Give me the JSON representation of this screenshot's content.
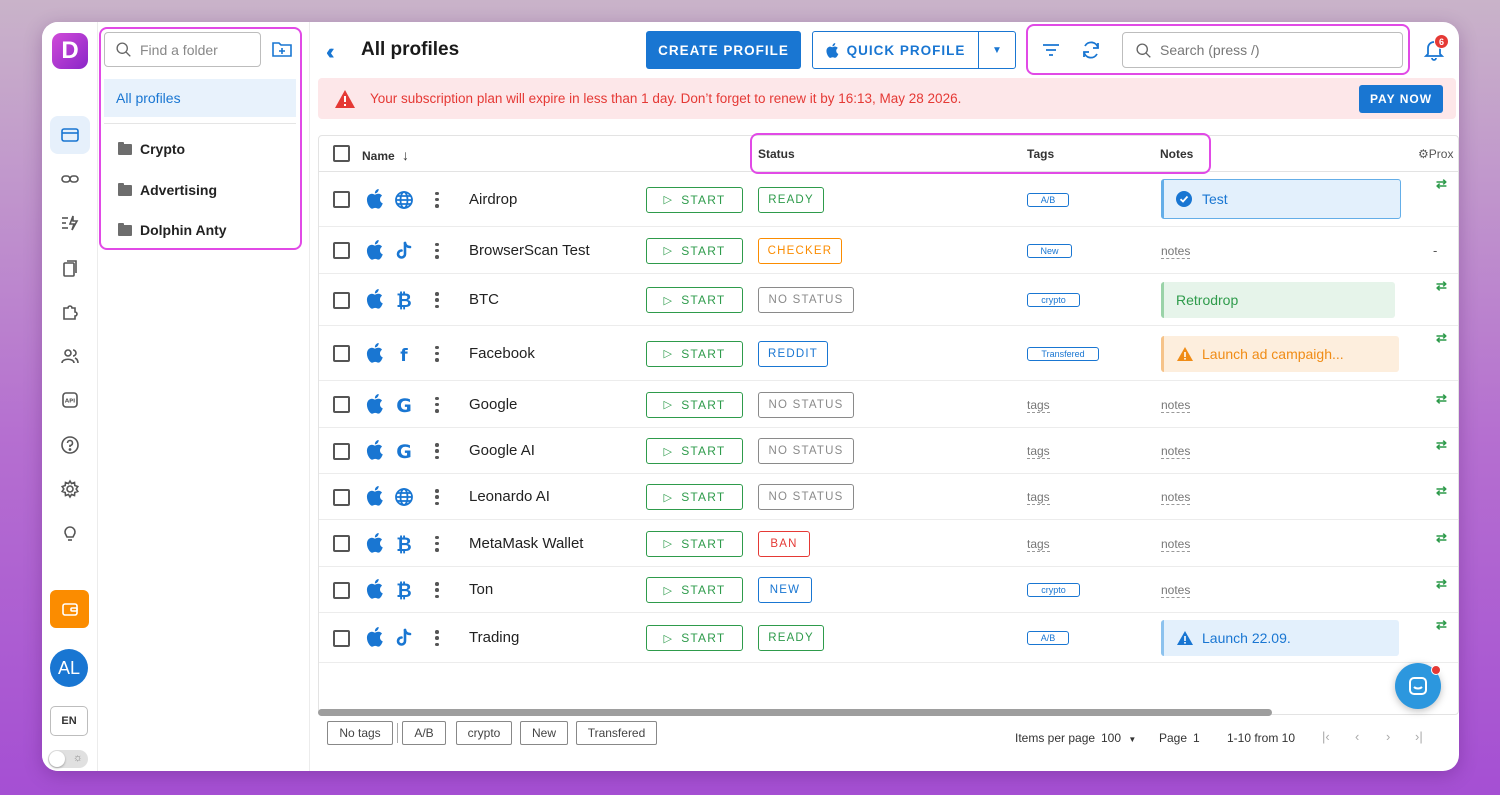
{
  "colors": {
    "accent": "#1976d2",
    "green": "#2e9b4b",
    "orange": "#fb8c00",
    "red": "#e53935",
    "highlight": "#e14ae6"
  },
  "rail": {
    "logo": "D",
    "items": [
      "browser-icon",
      "link-icon",
      "automation-icon",
      "clipboard-icon",
      "extension-icon",
      "users-icon",
      "api-icon",
      "help-icon",
      "settings-icon",
      "lightbulb-icon"
    ],
    "api_label": "API",
    "wallet_icon": "wallet-icon",
    "avatar": "AL",
    "language": "EN"
  },
  "folders": {
    "search_placeholder": "Find a folder",
    "all_label": "All profiles",
    "items": [
      "Crypto",
      "Advertising",
      "Dolphin Anty"
    ]
  },
  "header": {
    "title": "All profiles",
    "create_label": "CREATE PROFILE",
    "quick_label": "QUICK PROFILE",
    "search_placeholder": "Search (press /)",
    "notifications": "6"
  },
  "alert": {
    "message": "Your subscription plan will expire in less than 1 day. Don’t forget to renew it by 16:13, May 28 2026.",
    "action": "PAY NOW"
  },
  "table": {
    "columns": {
      "name": "Name",
      "status": "Status",
      "tags": "Tags",
      "notes": "Notes",
      "proxy": "Prox"
    },
    "start_label": "START",
    "rows": [
      {
        "name": "Airdrop",
        "site_icon": "globe-icon",
        "status": "READY",
        "tag": "A/B",
        "note": "Test"
      },
      {
        "name": "BrowserScan Test",
        "site_icon": "tiktok-icon",
        "status": "CHECKER",
        "tag": "New",
        "note": "notes"
      },
      {
        "name": "BTC",
        "site_icon": "bitcoin-icon",
        "status": "NO STATUS",
        "tag": "crypto",
        "note": "Retrodrop"
      },
      {
        "name": "Facebook",
        "site_icon": "facebook-icon",
        "status": "REDDIT",
        "tag": "Transfered",
        "note": "Launch ad campaigh..."
      },
      {
        "name": "Google",
        "site_icon": "google-icon",
        "status": "NO STATUS",
        "tag": "tags",
        "note": "notes"
      },
      {
        "name": "Google AI",
        "site_icon": "google-icon",
        "status": "NO STATUS",
        "tag": "tags",
        "note": "notes"
      },
      {
        "name": "Leonardo AI",
        "site_icon": "globe-icon",
        "status": "NO STATUS",
        "tag": "tags",
        "note": "notes"
      },
      {
        "name": "MetaMask Wallet",
        "site_icon": "bitcoin-icon",
        "status": "BAN",
        "tag": "tags",
        "note": "notes"
      },
      {
        "name": "Ton",
        "site_icon": "bitcoin-icon",
        "status": "NEW",
        "tag": "crypto",
        "note": "notes"
      },
      {
        "name": "Trading",
        "site_icon": "tiktok-icon",
        "status": "READY",
        "tag": "A/B",
        "note": "Launch 22.09."
      }
    ],
    "row2_proxy": "-"
  },
  "footer": {
    "tag_chips": [
      "No tags",
      "A/B",
      "crypto",
      "New",
      "Transfered"
    ],
    "items_per_page_label": "Items per page",
    "items_per_page": "100",
    "page_label": "Page",
    "page": "1",
    "range": "1-10 from 10"
  }
}
